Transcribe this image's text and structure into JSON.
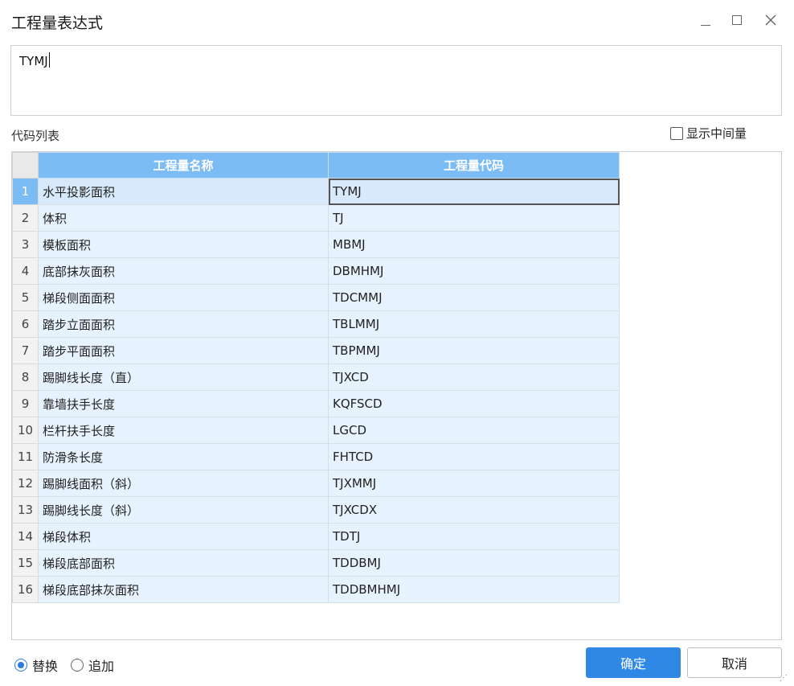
{
  "window": {
    "title": "工程量表达式"
  },
  "expression": {
    "value": "TYMJ"
  },
  "code_list": {
    "label": "代码列表",
    "show_intermediate_label": "显示中间量",
    "show_intermediate_checked": false,
    "columns": [
      "工程量名称",
      "工程量代码"
    ],
    "selected_row": 1,
    "rows": [
      {
        "num": "1",
        "name": "水平投影面积",
        "code": "TYMJ"
      },
      {
        "num": "2",
        "name": "体积",
        "code": "TJ"
      },
      {
        "num": "3",
        "name": "模板面积",
        "code": "MBMJ"
      },
      {
        "num": "4",
        "name": "底部抹灰面积",
        "code": "DBMHMJ"
      },
      {
        "num": "5",
        "name": "梯段侧面面积",
        "code": "TDCMMJ"
      },
      {
        "num": "6",
        "name": "踏步立面面积",
        "code": "TBLMMJ"
      },
      {
        "num": "7",
        "name": "踏步平面面积",
        "code": "TBPMMJ"
      },
      {
        "num": "8",
        "name": "踢脚线长度（直）",
        "code": "TJXCD"
      },
      {
        "num": "9",
        "name": "靠墙扶手长度",
        "code": "KQFSCD"
      },
      {
        "num": "10",
        "name": "栏杆扶手长度",
        "code": "LGCD"
      },
      {
        "num": "11",
        "name": "防滑条长度",
        "code": "FHTCD"
      },
      {
        "num": "12",
        "name": "踢脚线面积（斜）",
        "code": "TJXMMJ"
      },
      {
        "num": "13",
        "name": "踢脚线长度（斜）",
        "code": "TJXCDX"
      },
      {
        "num": "14",
        "name": "梯段体积",
        "code": "TDTJ"
      },
      {
        "num": "15",
        "name": "梯段底部面积",
        "code": "TDDBMJ"
      },
      {
        "num": "16",
        "name": "梯段底部抹灰面积",
        "code": "TDDBMHMJ"
      }
    ]
  },
  "mode": {
    "replace_label": "替换",
    "append_label": "追加",
    "selected": "replace"
  },
  "buttons": {
    "ok_label": "确定",
    "cancel_label": "取消"
  },
  "colors": {
    "header_blue": "#7cbcf5",
    "row_fill": "#e6f2fd",
    "primary_button": "#2f87e6"
  }
}
